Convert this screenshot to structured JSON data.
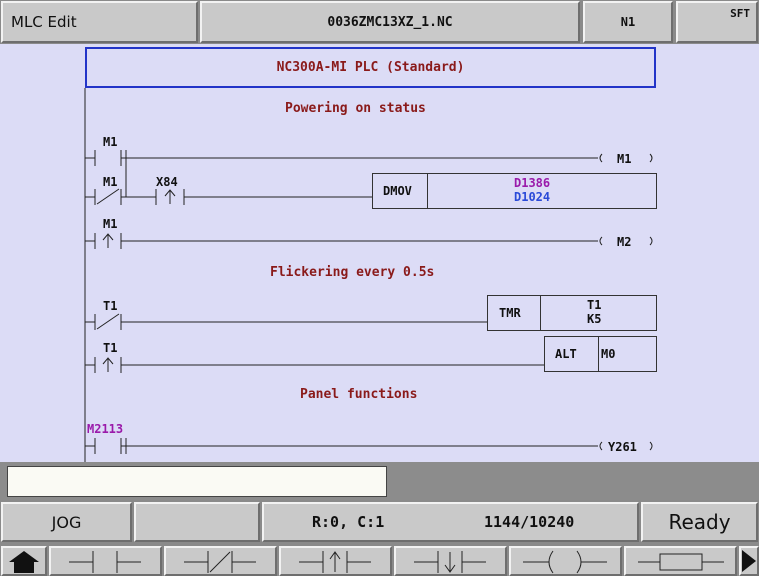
{
  "titlebar": {
    "mode": "MLC Edit",
    "filename": "0036ZMC13XZ_1.NC",
    "channel": "N1",
    "shift": "SFT"
  },
  "editor": {
    "banner": "NC300A-MI PLC (Standard)",
    "section_1": {
      "comment": "Powering on status",
      "rung_1": {
        "contact": "M1",
        "coil": "M1"
      },
      "rung_2": {
        "contact_1": "M1",
        "contact_2": "X84",
        "instruction": "DMOV",
        "operand_1": "D1386",
        "operand_2": "D1024"
      },
      "rung_3": {
        "contact": "M1",
        "coil": "M2"
      }
    },
    "section_2": {
      "comment": "Flickering every 0.5s",
      "rung_1": {
        "contact": "T1",
        "instruction": "TMR",
        "operand_1": "T1",
        "operand_2": "K5"
      },
      "rung_2": {
        "contact": "T1",
        "instruction": "ALT",
        "operand": "M0"
      }
    },
    "section_3": {
      "comment": "Panel functions",
      "rung_1": {
        "contact": "M2113",
        "coil": "Y261"
      }
    },
    "colors": {
      "background": "#dcdcf6",
      "comment": "#8a1a1a",
      "device_magenta": "#9a1aaa",
      "device_blue": "#2a4ad8",
      "banner_border": "#2234c8"
    }
  },
  "input": {
    "value": "",
    "placeholder": ""
  },
  "status": {
    "mode": "JOG",
    "position": "R:0, C:1",
    "steps": "1144/10240",
    "state": "Ready"
  },
  "softkeys": [
    {
      "name": "home-icon"
    },
    {
      "name": "normally-open-contact-icon"
    },
    {
      "name": "normally-closed-contact-icon"
    },
    {
      "name": "rising-edge-contact-icon"
    },
    {
      "name": "falling-edge-contact-icon"
    },
    {
      "name": "output-coil-icon"
    },
    {
      "name": "function-block-icon"
    },
    {
      "name": "next-page-arrow-icon"
    }
  ]
}
